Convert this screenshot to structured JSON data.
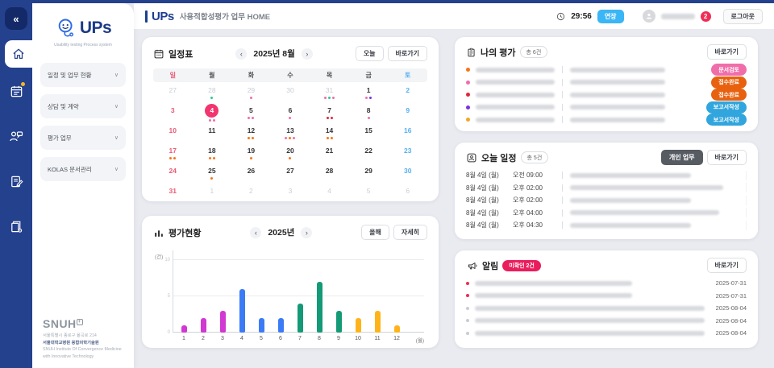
{
  "topbar": {
    "timer": "29:56",
    "extend_label": "연장",
    "logout_label": "로그아웃",
    "badge_count": "2"
  },
  "header": {
    "app": "UPs",
    "subtitle": "사용적합성평가 업무 HOME"
  },
  "sidebar": {
    "logo": "UPs",
    "logo_sub": "Usability testing Process system",
    "menu": [
      "일정 및 업무 현황",
      "상담 및 계약",
      "평가 업무",
      "KOLAS 문서관리"
    ],
    "footer_logo": "SNUH",
    "footer": [
      "서울특별시 종로구 율곡로 214",
      "서울대학교병원 융합의학기술원",
      "SNUH Institute Of Convergence Medicine",
      "with Innovative Technology"
    ]
  },
  "colors": {
    "dot": {
      "green": "#2ec98e",
      "pink": "#f06daa",
      "red": "#e02639",
      "orange": "#f97316",
      "purple": "#7a30e8"
    }
  },
  "calendar": {
    "title": "일정표",
    "month": "2025년 8월",
    "prev": "‹",
    "next": "›",
    "today_btn": "오늘",
    "shortcut_btn": "바로가기",
    "weekdays": [
      "일",
      "월",
      "화",
      "수",
      "목",
      "금",
      "토"
    ],
    "weeks": [
      [
        {
          "d": 27,
          "t": "out"
        },
        {
          "d": 28,
          "t": "out",
          "dots": [
            "green"
          ]
        },
        {
          "d": 29,
          "t": "out",
          "dots": [
            "pink"
          ]
        },
        {
          "d": 30,
          "t": "out"
        },
        {
          "d": 31,
          "t": "out",
          "dots": [
            "pink",
            "green",
            "pink"
          ]
        },
        {
          "d": 1,
          "t": "wk",
          "dots": [
            "pink",
            "purple"
          ]
        },
        {
          "d": 2,
          "t": "sat"
        }
      ],
      [
        {
          "d": 3,
          "t": "sun"
        },
        {
          "d": 4,
          "t": "sel",
          "dots": [
            "pink",
            "pink"
          ]
        },
        {
          "d": 5,
          "t": "wk",
          "dots": [
            "pink",
            "pink"
          ]
        },
        {
          "d": 6,
          "t": "wk",
          "dots": [
            "pink"
          ]
        },
        {
          "d": 7,
          "t": "wk",
          "dots": [
            "red",
            "red"
          ]
        },
        {
          "d": 8,
          "t": "wk",
          "dots": [
            "pink"
          ]
        },
        {
          "d": 9,
          "t": "sat"
        }
      ],
      [
        {
          "d": 10,
          "t": "sun"
        },
        {
          "d": 11,
          "t": "wk"
        },
        {
          "d": 12,
          "t": "wk",
          "dots": [
            "orange",
            "orange"
          ]
        },
        {
          "d": 13,
          "t": "wk",
          "dots": [
            "pink",
            "orange",
            "pink"
          ]
        },
        {
          "d": 14,
          "t": "wk",
          "dots": [
            "orange",
            "orange"
          ]
        },
        {
          "d": 15,
          "t": "wk"
        },
        {
          "d": 16,
          "t": "sat"
        }
      ],
      [
        {
          "d": 17,
          "t": "sun",
          "dots": [
            "orange",
            "orange"
          ]
        },
        {
          "d": 18,
          "t": "wk",
          "dots": [
            "orange",
            "orange"
          ]
        },
        {
          "d": 19,
          "t": "wk",
          "dots": [
            "orange"
          ]
        },
        {
          "d": 20,
          "t": "wk",
          "dots": [
            "orange"
          ]
        },
        {
          "d": 21,
          "t": "wk"
        },
        {
          "d": 22,
          "t": "wk"
        },
        {
          "d": 23,
          "t": "sat"
        }
      ],
      [
        {
          "d": 24,
          "t": "sun"
        },
        {
          "d": 25,
          "t": "wk",
          "dots": [
            "orange"
          ]
        },
        {
          "d": 26,
          "t": "wk"
        },
        {
          "d": 27,
          "t": "wk"
        },
        {
          "d": 28,
          "t": "wk"
        },
        {
          "d": 29,
          "t": "wk"
        },
        {
          "d": 30,
          "t": "sat"
        }
      ],
      [
        {
          "d": 31,
          "t": "sun"
        },
        {
          "d": 1,
          "t": "out"
        },
        {
          "d": 2,
          "t": "out"
        },
        {
          "d": 3,
          "t": "out"
        },
        {
          "d": 4,
          "t": "out"
        },
        {
          "d": 5,
          "t": "out"
        },
        {
          "d": 6,
          "t": "out"
        }
      ]
    ]
  },
  "chart_data": {
    "type": "bar",
    "title": "평가현황",
    "year": "2025년",
    "prev": "‹",
    "next": "›",
    "buttons": {
      "this_year": "올해",
      "detail": "자세히"
    },
    "categories": [
      1,
      2,
      3,
      4,
      5,
      6,
      7,
      8,
      9,
      10,
      11,
      12
    ],
    "values": [
      1,
      2,
      3,
      6,
      2,
      2,
      4,
      7,
      3,
      2,
      3,
      1
    ],
    "bar_colors": [
      "#d238d2",
      "#d238d2",
      "#d238d2",
      "#3b7bf5",
      "#3b7bf5",
      "#3b7bf5",
      "#149a77",
      "#149a77",
      "#149a77",
      "#ffb31a",
      "#ffb31a",
      "#ffb31a"
    ],
    "ylabel": "(건)",
    "xlabel": "(월)",
    "ylim": [
      0,
      10
    ],
    "yticks": [
      0,
      5,
      10
    ],
    "grid": true,
    "legend": false
  },
  "my_eval": {
    "title": "나의 평가",
    "count": "총 6건",
    "shortcut_btn": "바로가기",
    "rows": [
      {
        "dot": "#f97316",
        "status": "문서검토",
        "status_color": "#f06daa"
      },
      {
        "dot": "#f06daa",
        "status": "접수완료",
        "status_color": "#e8610f"
      },
      {
        "dot": "#e02639",
        "status": "접수완료",
        "status_color": "#e8610f"
      },
      {
        "dot": "#7a30e8",
        "status": "보고서작성",
        "status_color": "#31a5dd"
      },
      {
        "dot": "#f5a623",
        "status": "보고서작성",
        "status_color": "#31a5dd"
      }
    ]
  },
  "today": {
    "title": "오늘 일정",
    "count": "총 5건",
    "personal_btn": "개인 업무",
    "shortcut_btn": "바로가기",
    "rows": [
      {
        "date": "8월 4일 (월)",
        "time": "오전 09:00"
      },
      {
        "date": "8월 4일 (월)",
        "time": "오후 02:00"
      },
      {
        "date": "8월 4일 (월)",
        "time": "오후 02:00"
      },
      {
        "date": "8월 4일 (월)",
        "time": "오후 04:00"
      },
      {
        "date": "8월 4일 (월)",
        "time": "오후 04:30"
      }
    ]
  },
  "alerts": {
    "title": "알림",
    "badge": "미확인 2건",
    "shortcut_btn": "바로가기",
    "unread_color": "#ee2d4f",
    "read_color": "#c9ccd3",
    "rows": [
      {
        "date": "2025-07-31",
        "unread": true
      },
      {
        "date": "2025-07-31",
        "unread": true
      },
      {
        "date": "2025-08-04",
        "unread": false
      },
      {
        "date": "2025-08-04",
        "unread": false
      },
      {
        "date": "2025-08-04",
        "unread": false
      }
    ]
  }
}
